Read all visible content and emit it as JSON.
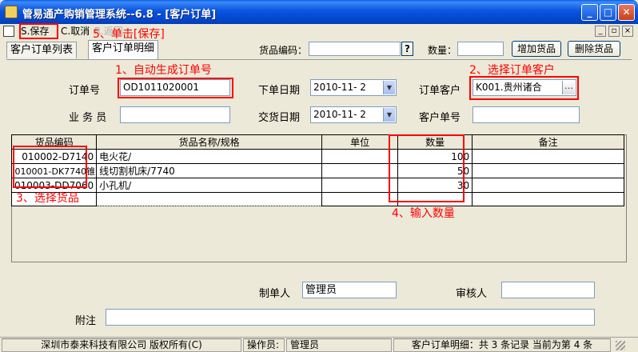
{
  "window": {
    "title": "管易通产购销管理系统--6.8 - [客户订单]"
  },
  "window_buttons": {
    "minimize": "_",
    "maximize": "□",
    "close": "✕"
  },
  "mdi_buttons": {
    "minimize": "_",
    "restore": "▫",
    "close": "×"
  },
  "toolbar": {
    "save_label": "S.保存",
    "cancel_label": "C.取消",
    "extra_label": "R.返回"
  },
  "tabs": [
    {
      "label": "客户订单列表"
    },
    {
      "label": "客户订单明细"
    }
  ],
  "search": {
    "code_label": "货品编码：",
    "code_value": "",
    "help_btn": "?",
    "qty_label": "数量：",
    "qty_value": "",
    "add_btn": "增加货品",
    "delete_btn": "删除货品"
  },
  "form": {
    "order_no_label": "订单号",
    "order_no": "OD1011020001",
    "order_date_label": "下单日期",
    "order_date": "2010-11- 2",
    "customer_label": "订单客户",
    "customer": "K001.贵州诸合",
    "customer_btn": "…",
    "salesman_label": "业 务 员",
    "salesman": "",
    "delivery_date_label": "交货日期",
    "delivery_date": "2010-11- 2",
    "customer_order_label": "客户单号",
    "customer_order": ""
  },
  "grid": {
    "headers": [
      "货品编码",
      "货品名称/规格",
      "单位",
      "数量",
      "备注"
    ],
    "rows": [
      {
        "code": "010002-D7140",
        "name": "电火花/",
        "unit": "",
        "qty": "100",
        "note": ""
      },
      {
        "code": "010001-DK7740锥",
        "name": "线切割机床/7740",
        "unit": "",
        "qty": "50",
        "note": ""
      },
      {
        "code": "010003-DD7060",
        "name": "小孔机/",
        "unit": "",
        "qty": "30",
        "note": ""
      },
      {
        "code": "",
        "name": "",
        "unit": "",
        "qty": "",
        "note": ""
      }
    ]
  },
  "footer": {
    "maker_label": "制单人",
    "maker": "管理员",
    "reviewer_label": "审核人",
    "reviewer": "",
    "remark_label": "附注",
    "remark": ""
  },
  "annotations": {
    "step1": "1、自动生成订单号",
    "step2": "2、选择订单客户",
    "step3": "3、选择货品",
    "step4": "4、输入数量",
    "step5": "5、单击[保存]"
  },
  "status": {
    "company": "深圳市泰来科技有限公司 版权所有(C)",
    "operator_label": "操作员:",
    "operator": "管理员",
    "record_info": "客户订单明细：共 3 条记录 当前为第 4 条"
  },
  "colors": {
    "annotation": "#ff0000",
    "title_bar": "#0a54e0",
    "window_bg": "#ece9d8"
  }
}
